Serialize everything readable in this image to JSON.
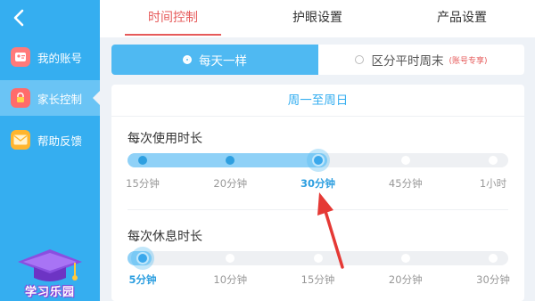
{
  "sidebar": {
    "items": [
      {
        "label": "我的账号",
        "icon": "account-card-icon"
      },
      {
        "label": "家长控制",
        "icon": "lock-icon",
        "active": true
      },
      {
        "label": "帮助反馈",
        "icon": "mail-icon"
      }
    ],
    "promo_text": "学习乐园"
  },
  "tabs": [
    {
      "label": "时间控制",
      "active": true
    },
    {
      "label": "护眼设置"
    },
    {
      "label": "产品设置"
    }
  ],
  "mode": {
    "option_same": "每天一样",
    "option_split": "区分平时周末",
    "vip_badge": "(账号专享)"
  },
  "card": {
    "title": "周一至周日",
    "usage": {
      "title": "每次使用时长",
      "ticks": [
        "15分钟",
        "20分钟",
        "30分钟",
        "45分钟",
        "1小时"
      ],
      "selected_index": 2
    },
    "rest": {
      "title": "每次休息时长",
      "ticks": [
        "5分钟",
        "10分钟",
        "15分钟",
        "20分钟",
        "30分钟"
      ],
      "selected_index": 0
    }
  },
  "colors": {
    "accent": "#35aef0",
    "tab_active": "#e65a5a",
    "annotation_arrow": "#e53935"
  }
}
